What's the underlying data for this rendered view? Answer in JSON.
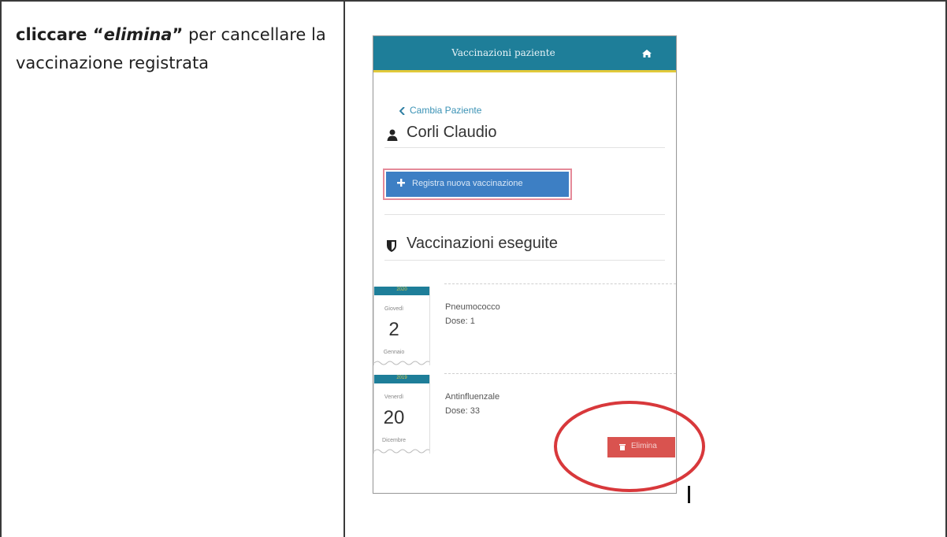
{
  "instruction": {
    "prefix": "cliccare “",
    "keyword": "elimina",
    "suffix_bold": "”",
    "rest": " per cancellare la vaccinazione registrata"
  },
  "app": {
    "title": "Vaccinazioni paziente",
    "back_label": "Cambia Paziente",
    "patient_name": "Corli Claudio",
    "register_button": "Registra nuova vaccinazione",
    "section_title": "Vaccinazioni eseguite",
    "records": [
      {
        "year": "2020",
        "weekday": "Giovedì",
        "day": "2",
        "month": "Gennaio",
        "name": "Pneumococco",
        "dose": "Dose: 1"
      },
      {
        "year": "2019",
        "weekday": "Venerdì",
        "day": "20",
        "month": "Dicembre",
        "name": "Antinfluenzale",
        "dose": "Dose: 33"
      }
    ],
    "delete_button": "Elimina"
  },
  "colors": {
    "header": "#1e7e99",
    "header_accent": "#e2c93a",
    "primary_button": "#3d7fc4",
    "danger_button": "#d9534f",
    "highlight_circle": "#d8383b"
  }
}
